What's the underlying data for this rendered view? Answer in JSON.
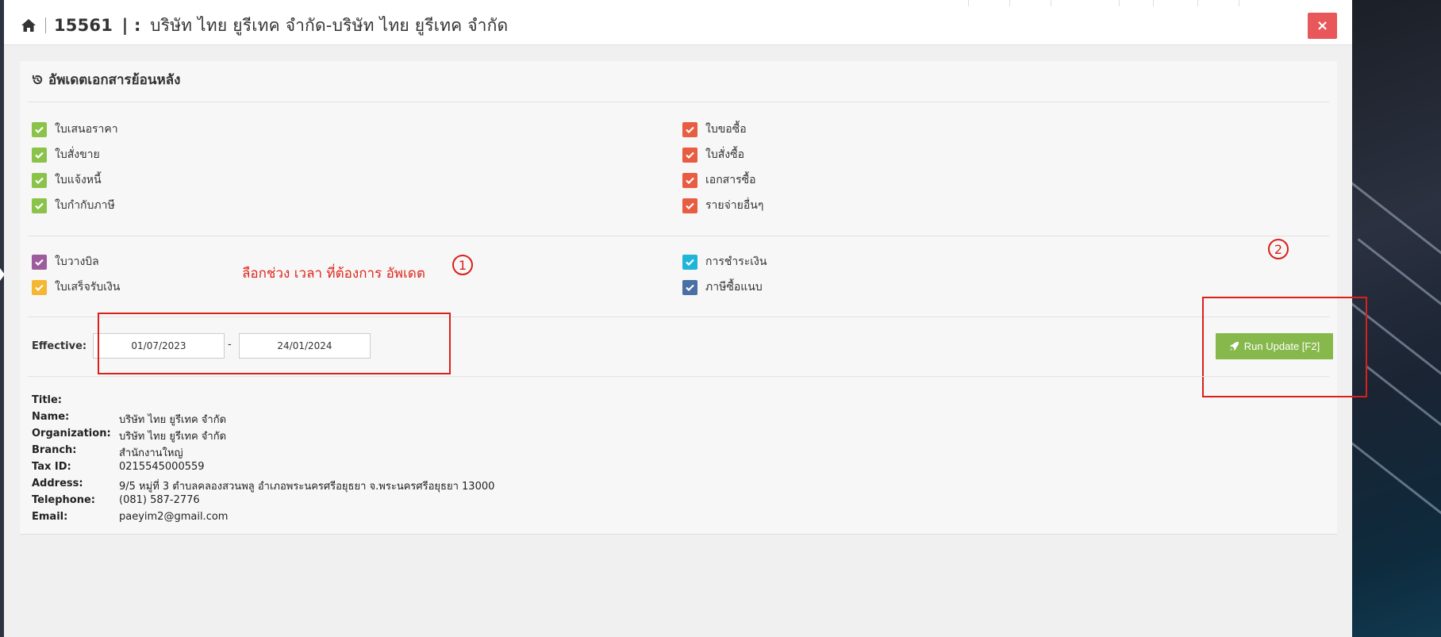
{
  "header": {
    "id": "15561",
    "separator": "| :",
    "title": "บริษัท ไทย ยูรีเทค จำกัด-บริษัท ไทย ยูรีเทค จำกัด",
    "close_label": "×"
  },
  "panel": {
    "title": "อัพเดตเอกสารย้อนหลัง",
    "left_group_a": [
      {
        "label": "ใบเสนอราคา",
        "color": "#8bc34a"
      },
      {
        "label": "ใบสั่งขาย",
        "color": "#8bc34a"
      },
      {
        "label": "ใบแจ้งหนี้",
        "color": "#8bc34a"
      },
      {
        "label": "ใบกำกับภาษี",
        "color": "#8bc34a"
      }
    ],
    "right_group_a": [
      {
        "label": "ใบขอซื้อ",
        "color": "#e85c41"
      },
      {
        "label": "ใบสั่งซื้อ",
        "color": "#e85c41"
      },
      {
        "label": "เอกสารซื้อ",
        "color": "#e85c41"
      },
      {
        "label": "รายจ่ายอื่นๆ",
        "color": "#e85c41"
      }
    ],
    "left_group_b": [
      {
        "label": "ใบวางบิล",
        "color": "#9c5c9e"
      },
      {
        "label": "ใบเสร็จรับเงิน",
        "color": "#f5b731"
      }
    ],
    "right_group_b": [
      {
        "label": "การชำระเงิน",
        "color": "#1fb5d9"
      },
      {
        "label": "ภาษีซื้อแนบ",
        "color": "#4a6fa5"
      }
    ],
    "effective_label": "Effective:",
    "date_from": "01/07/2023",
    "date_sep": "-",
    "date_to": "24/01/2024",
    "run_button": "Run Update [F2]"
  },
  "annotations": {
    "note_1": "ลือกช่วง เวลา ที่ต้องการ อัพเดต",
    "circle_1": "1",
    "circle_2": "2"
  },
  "info": [
    {
      "key": "Title:",
      "value": ""
    },
    {
      "key": "Name:",
      "value": "บริษัท ไทย ยูรีเทค จำกัด"
    },
    {
      "key": "Organization:",
      "value": "บริษัท ไทย ยูรีเทค จำกัด"
    },
    {
      "key": "Branch:",
      "value": "สำนักงานใหญ่"
    },
    {
      "key": "Tax ID:",
      "value": "0215545000559"
    },
    {
      "key": "Address:",
      "value": "9/5 หมู่ที่ 3 ตำบลคลองสวนพลู อำเภอพระนครศรีอยุธยา จ.พระนครศรีอยุธยา 13000"
    },
    {
      "key": "Telephone:",
      "value": "(081) 587-2776"
    },
    {
      "key": "Email:",
      "value": "paeyim2@gmail.com"
    }
  ]
}
